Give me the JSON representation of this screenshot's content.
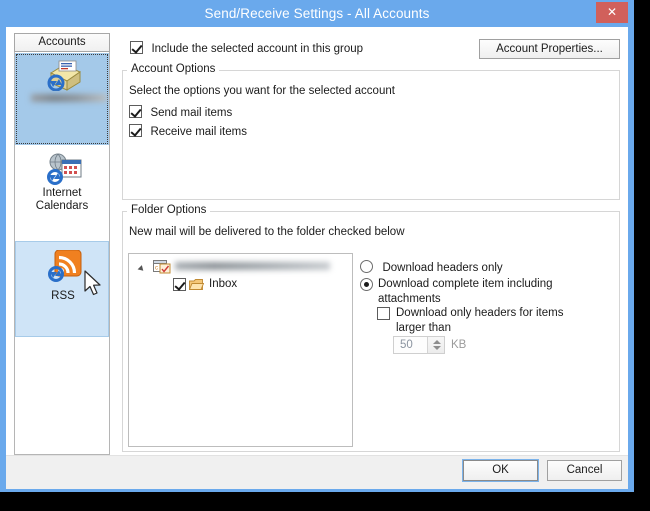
{
  "window": {
    "title": "Send/Receive Settings - All Accounts",
    "close_glyph": "✕"
  },
  "sidebar": {
    "header": "Accounts",
    "items": [
      {
        "label": "",
        "icon": "send-receive-account-icon",
        "state": "selected"
      },
      {
        "label_line1": "Internet",
        "label_line2": "Calendars",
        "icon": "internet-calendars-icon",
        "state": "normal"
      },
      {
        "label": "RSS",
        "icon": "rss-icon",
        "state": "highlighted"
      }
    ]
  },
  "main": {
    "include_account": {
      "label": "Include the selected account in this group",
      "checked": true
    },
    "account_properties_button": "Account Properties...",
    "account_options": {
      "legend": "Account Options",
      "description": "Select the options you want for the selected account",
      "send_mail": {
        "label": "Send mail items",
        "checked": true
      },
      "receive_mail": {
        "label": "Receive mail items",
        "checked": true
      }
    },
    "folder_options": {
      "legend": "Folder Options",
      "description": "New mail will be delivered to the folder checked below",
      "tree": {
        "root_label": "",
        "child_label": "Inbox",
        "child_checked": true
      },
      "radio_headers_only": {
        "label": "Download headers only",
        "selected": false
      },
      "radio_complete_line1": "Download complete item including",
      "radio_complete_line2": "attachments",
      "radio_complete_selected": true,
      "sub_checkbox_line1": "Download only headers for items",
      "sub_checkbox_line2": "larger than",
      "sub_checkbox_checked": false,
      "size_value": "50",
      "size_unit": "KB"
    }
  },
  "footer": {
    "ok": "OK",
    "cancel": "Cancel"
  },
  "colors": {
    "window_frame": "#6aa9ec",
    "close_button": "#d1605b",
    "selected_item": "#a4c9e9",
    "highlight_item": "#cfe4f7",
    "rss_orange": "#f08020"
  }
}
